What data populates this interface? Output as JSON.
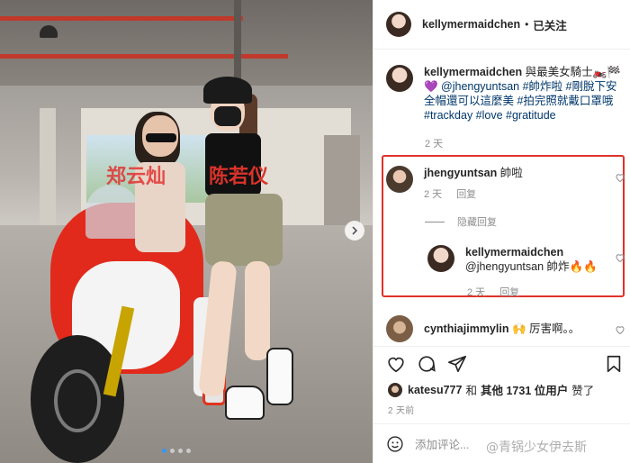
{
  "photo": {
    "label_left": "郑云灿",
    "label_right": "陈若仪",
    "next_icon": "chevron-right-icon",
    "carousel_total": 4,
    "carousel_active": 1
  },
  "header": {
    "username": "kellymermaidchen",
    "separator": "•",
    "follow_label": "已关注"
  },
  "caption": {
    "username": "kellymermaidchen",
    "line1": "與最美女騎士🏍️🏁",
    "line2": "💜 @jhengyuntsan #帥炸啦 #剛脫下安全帽還可以這麼美 #拍完照就戴口罩哦 #trackday #love #gratitude",
    "time": "2 天"
  },
  "comments": [
    {
      "username": "jhengyuntsan",
      "text": "帥啦",
      "time": "2 天",
      "reply_label": "回复"
    }
  ],
  "replies_toggle": "隐藏回复",
  "reply": {
    "username": "kellymermaidchen",
    "text": "@jhengyuntsan 帥炸🔥🔥",
    "time": "2 天",
    "reply_label": "回复"
  },
  "comment2": {
    "username": "cynthiajimmylin",
    "text": "🙌 厉害啊。。"
  },
  "likes": {
    "username": "katesu777",
    "connector": "和",
    "others": "其他 1731 位用户",
    "suffix": "赞了"
  },
  "post_time": "2 天前",
  "add_comment_placeholder": "添加评论...",
  "watermark": "@青锅少女伊去斯",
  "colors": {
    "highlight": "#e0322a",
    "link": "#00376b",
    "muted": "#8e8e8e",
    "carousel_active": "#3897f0"
  }
}
